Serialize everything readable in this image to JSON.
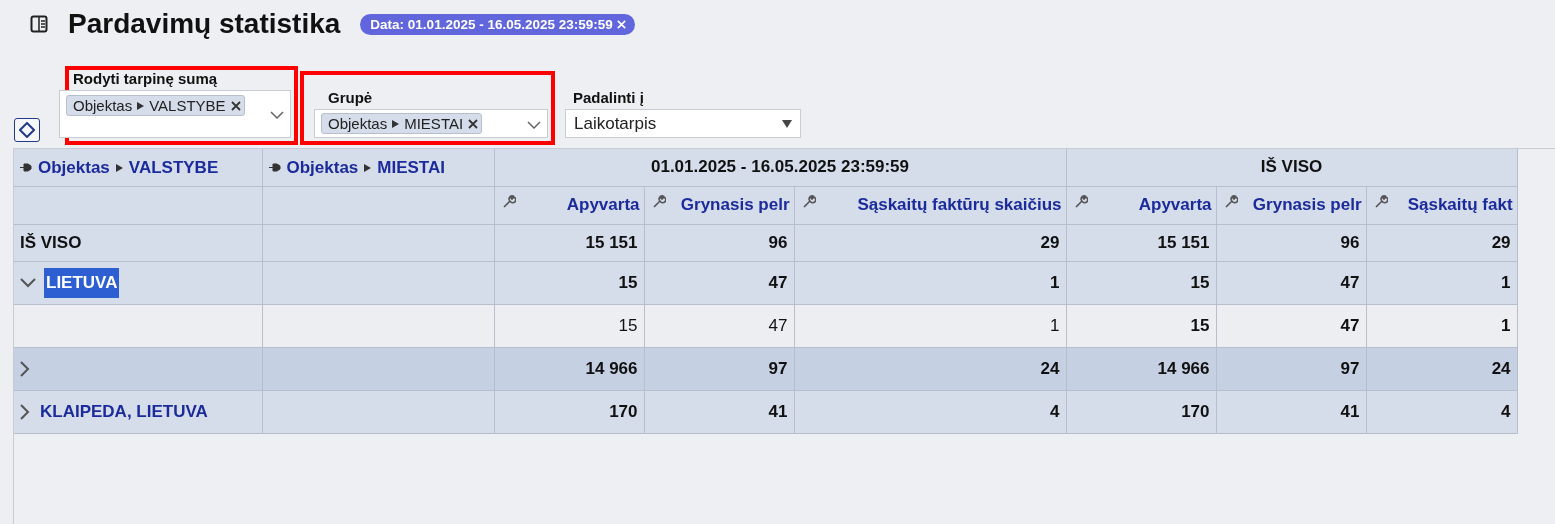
{
  "page": {
    "title": "Pardavimų statistika",
    "filter_chip": "Data: 01.01.2025 - 16.05.2025 23:59:59"
  },
  "filters": [
    {
      "kind": "multiselect",
      "label": "Rodyti tarpinę sumą",
      "tags": [
        {
          "field": "Objektas",
          "attribute": "VALSTYBE"
        }
      ],
      "highlighted": true
    },
    {
      "kind": "multiselect",
      "label": "Grupė",
      "tags": [
        {
          "field": "Objektas",
          "attribute": "MIESTAI"
        }
      ],
      "highlighted": true
    },
    {
      "kind": "select",
      "label": "Padalinti į",
      "value": "Laikotarpis",
      "highlighted": false
    }
  ],
  "table": {
    "row_dimensions": [
      {
        "field": "Objektas",
        "attribute": "VALSTYBE"
      },
      {
        "field": "Objektas",
        "attribute": "MIESTAI"
      }
    ],
    "column_groups": [
      {
        "title": "01.01.2025 - 16.05.2025 23:59:59",
        "measures": [
          "Apyvarta",
          "Grynasis pelr",
          "Sąskaitų faktūrų skaičius"
        ]
      },
      {
        "title": "IŠ VISO",
        "measures": [
          "Apyvarta",
          "Grynasis pelr",
          "Sąskaitų fakt"
        ]
      }
    ],
    "rows": [
      {
        "kind": "total",
        "label": "IŠ VISO",
        "hovered": false,
        "values": [
          "15 151",
          "96",
          "29",
          "15 151",
          "96",
          "29"
        ]
      },
      {
        "kind": "group",
        "label": "LIETUVA",
        "expanded": true,
        "label_highlighted": true,
        "hovered": false,
        "values": [
          "15",
          "47",
          "1",
          "15",
          "47",
          "1"
        ]
      },
      {
        "kind": "detail",
        "hovered": false,
        "values": [
          "15",
          "47",
          "1",
          "15",
          "47",
          "1"
        ]
      },
      {
        "kind": "group",
        "expanded": false,
        "hovered": true,
        "values": [
          "14 966",
          "97",
          "24",
          "14 966",
          "97",
          "24"
        ]
      },
      {
        "kind": "group",
        "label": "KLAIPEDA, LIETUVA",
        "expanded": false,
        "label_highlighted": false,
        "hovered": false,
        "values": [
          "170",
          "41",
          "4",
          "170",
          "41",
          "4"
        ]
      }
    ]
  }
}
